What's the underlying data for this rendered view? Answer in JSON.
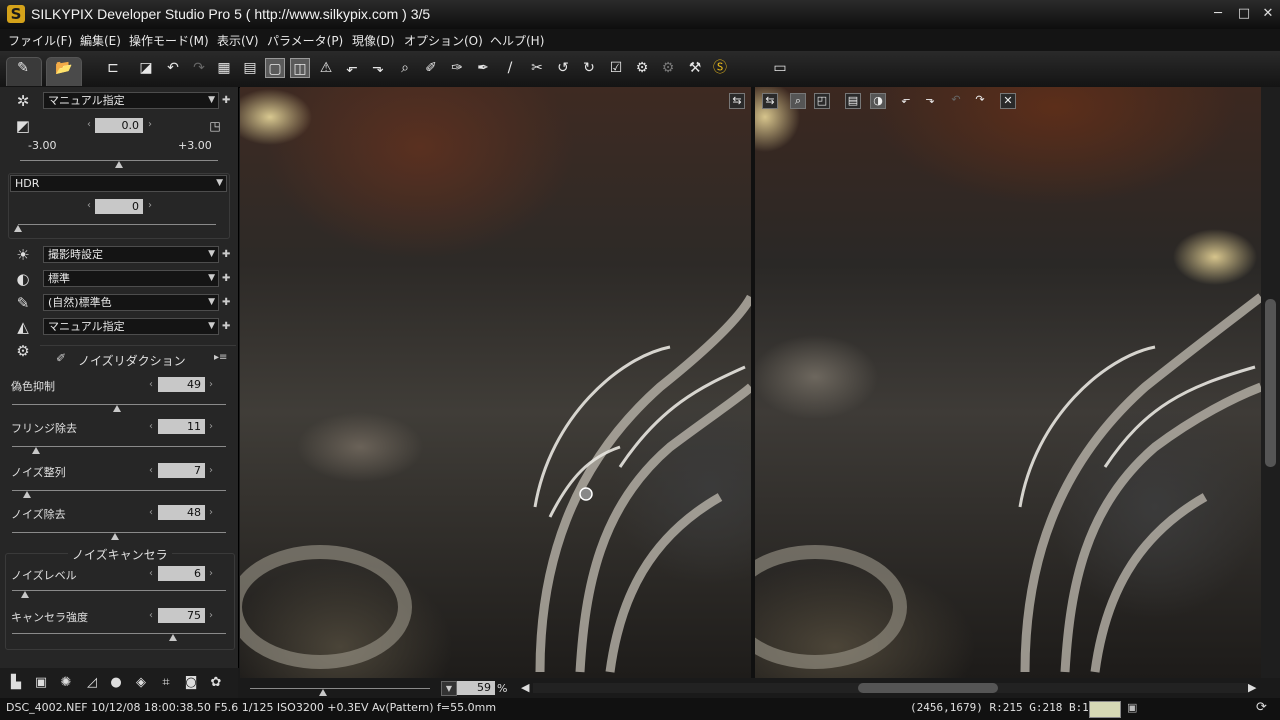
{
  "window": {
    "title": "SILKYPIX Developer Studio Pro 5 ( http://www.silkypix.com )   3/5",
    "app_icon_letter": "S",
    "minimize": "─",
    "maximize": "□",
    "close": "✕"
  },
  "menu": [
    "ファイル(F)",
    "編集(E)",
    "操作モード(M)",
    "表示(V)",
    "パラメータ(P)",
    "現像(D)",
    "オプション(O)",
    "ヘルプ(H)"
  ],
  "panel": {
    "white_balance_select": "マニュアル指定",
    "exposure": {
      "value": "0.0",
      "min_label": "-3.00",
      "max_label": "+3.00",
      "level": 0.5
    },
    "hdr": {
      "select": "HDR",
      "value": "0",
      "level": 0.0
    },
    "tone_select": "撮影時設定",
    "contrast_select": "標準",
    "color_select": "(自然)標準色",
    "sharpness_select": "マニュアル指定",
    "noise_reduction_title": "ノイズリダクション",
    "sliders": [
      {
        "label": "偽色抑制",
        "value": "49",
        "level": 0.49
      },
      {
        "label": "フリンジ除去",
        "value": "11",
        "level": 0.11
      },
      {
        "label": "ノイズ整列",
        "value": "7",
        "level": 0.07
      },
      {
        "label": "ノイズ除去",
        "value": "48",
        "level": 0.48
      }
    ],
    "noise_canceller": {
      "title": "ノイズキャンセラ",
      "sliders": [
        {
          "label": "ノイズレベル",
          "value": "6",
          "level": 0.06
        },
        {
          "label": "キャンセラ強度",
          "value": "75",
          "level": 0.75
        }
      ]
    }
  },
  "viewer": {
    "zoom_value": "59",
    "zoom_unit": "%"
  },
  "status": {
    "file_info": "DSC_4002.NEF 10/12/08 18:00:38.50 F5.6 1/125 ISO3200 +0.3EV Av(Pattern) f=55.0mm",
    "pixel_info": "(2456,1679) R:215 G:218 B:181"
  }
}
